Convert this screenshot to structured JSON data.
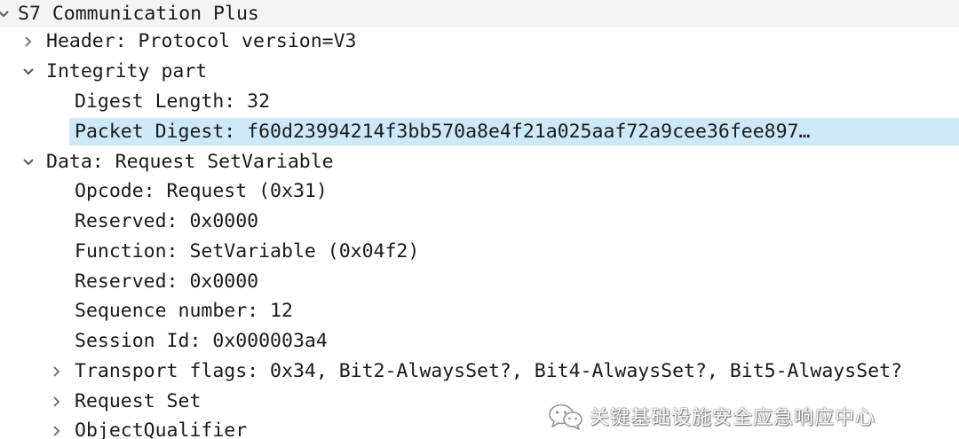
{
  "tree": {
    "root": "S7 Communication Plus",
    "header": "Header: Protocol version=V3",
    "integrity": {
      "label": "Integrity part",
      "digest_length": "Digest Length: 32",
      "packet_digest": "Packet Digest: f60d23994214f3bb570a8e4f21a025aaf72a9cee36fee897…"
    },
    "data": {
      "label": "Data: Request SetVariable",
      "opcode": "Opcode: Request (0x31)",
      "reserved1": "Reserved: 0x0000",
      "function": "Function: SetVariable (0x04f2)",
      "reserved2": "Reserved: 0x0000",
      "sequence_number": "Sequence number: 12",
      "session_id": "Session Id: 0x000003a4",
      "transport_flags": "Transport flags: 0x34, Bit2-AlwaysSet?, Bit4-AlwaysSet?, Bit5-AlwaysSet?",
      "request_set": "Request Set",
      "object_qualifier": "ObjectQualifier"
    }
  },
  "watermark": {
    "text": "关键基础设施安全应急响应中心",
    "icon": "wechat-icon"
  },
  "colors": {
    "selection": "#cde8f8",
    "root_background": "#f4f4f4",
    "arrow": "#555555"
  }
}
